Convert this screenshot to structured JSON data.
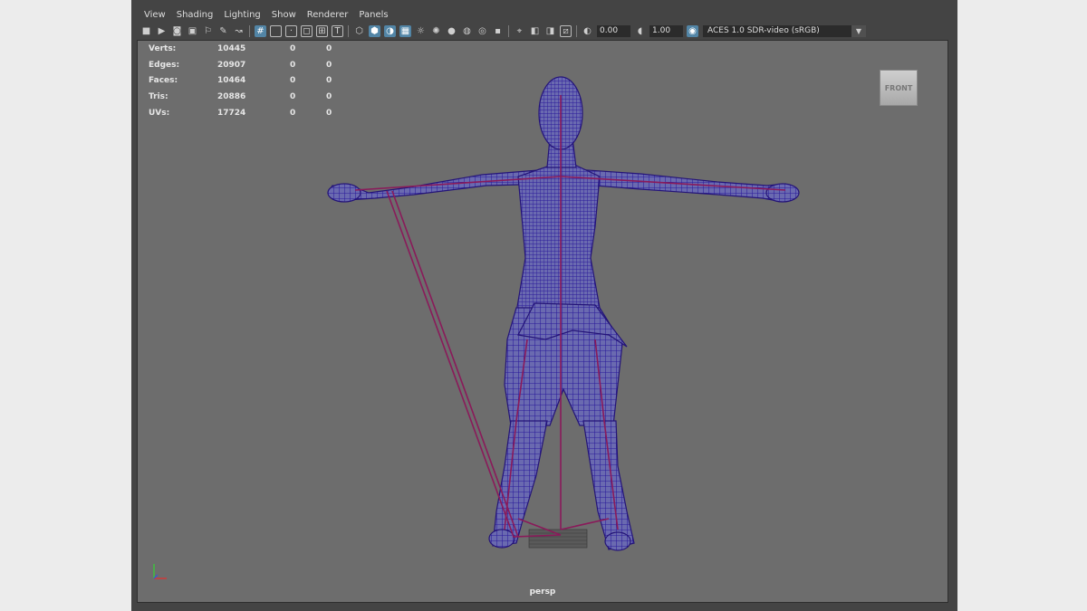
{
  "menu": [
    "View",
    "Shading",
    "Lighting",
    "Show",
    "Renderer",
    "Panels"
  ],
  "toolbar": {
    "exposure_value": "0.00",
    "gamma_value": "1.00",
    "color_space": "ACES 1.0 SDR-video (sRGB)"
  },
  "hud": {
    "rows": [
      {
        "label": "Verts:",
        "v1": "10445",
        "v2": "0",
        "v3": "0"
      },
      {
        "label": "Edges:",
        "v1": "20907",
        "v2": "0",
        "v3": "0"
      },
      {
        "label": "Faces:",
        "v1": "10464",
        "v2": "0",
        "v3": "0"
      },
      {
        "label": "Tris:",
        "v1": "20886",
        "v2": "0",
        "v3": "0"
      },
      {
        "label": "UVs:",
        "v1": "17724",
        "v2": "0",
        "v3": "0"
      }
    ]
  },
  "viewcube": {
    "label": "FRONT"
  },
  "camera": {
    "label": "persp"
  },
  "colors": {
    "wireframe": "#2a1a9a",
    "skeleton": "#8a1a5a",
    "viewport_bg": "#6d6d6d",
    "active_icon": "#5285a6"
  }
}
